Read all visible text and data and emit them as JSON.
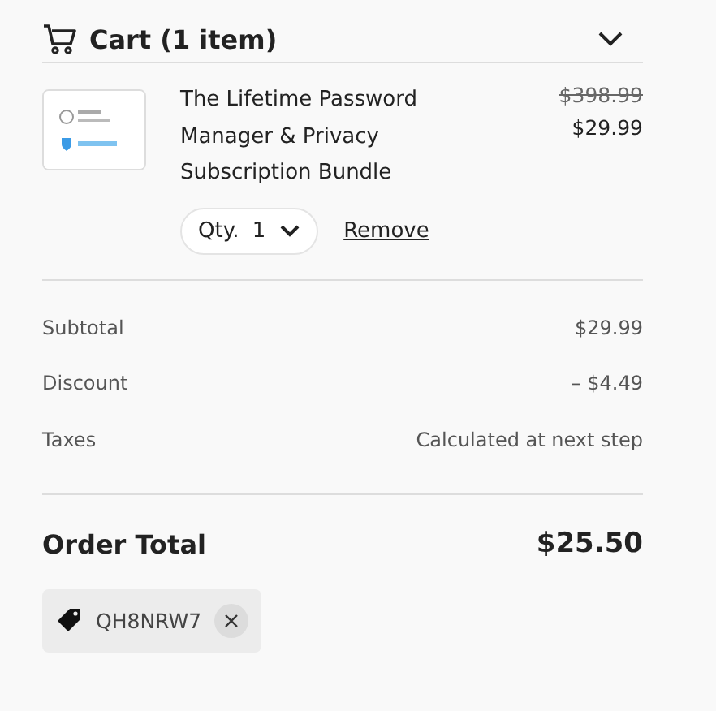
{
  "header": {
    "title": "Cart (1 item)",
    "expanded": true
  },
  "items": [
    {
      "name": "The Lifetime Password Manager & Privacy Subscription Bundle",
      "original_price": "$398.99",
      "price": "$29.99",
      "qty_label": "Qty.",
      "qty": "1",
      "remove": "Remove"
    }
  ],
  "summary": [
    {
      "label": "Subtotal",
      "value": "$29.99"
    },
    {
      "label": "Discount",
      "value": "– $4.49"
    },
    {
      "label": "Taxes",
      "value": "Calculated at next step"
    }
  ],
  "total": {
    "label": "Order Total",
    "value": "$25.50"
  },
  "coupon": {
    "code": "QH8NRW7"
  }
}
